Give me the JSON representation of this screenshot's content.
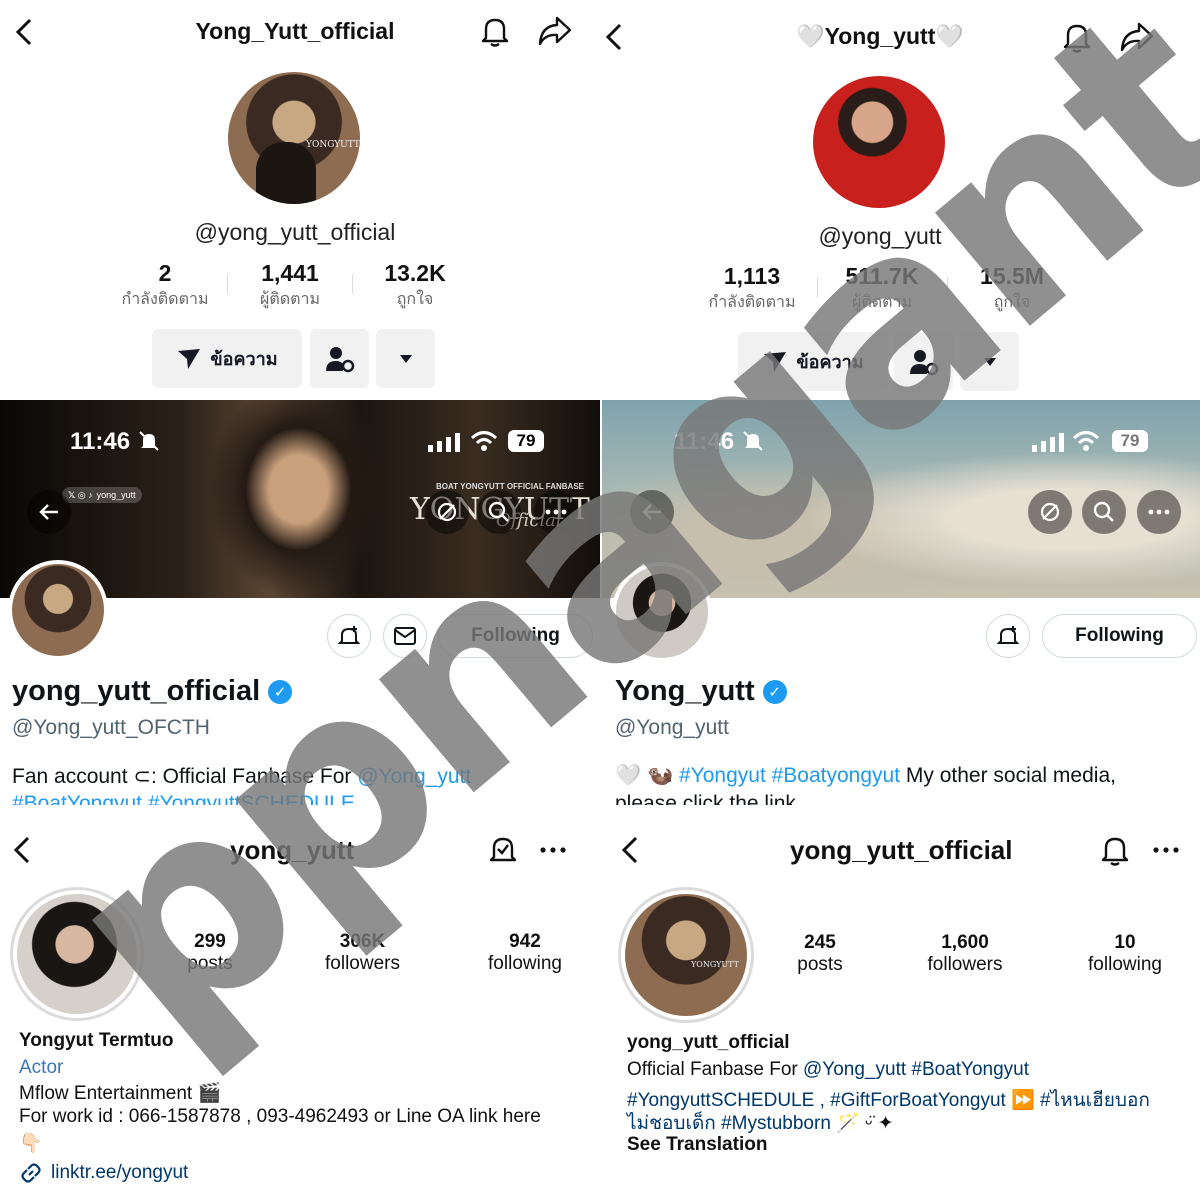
{
  "tiktok_official": {
    "title": "Yong_Yutt_official",
    "handle": "@yong_yutt_official",
    "stats": [
      {
        "value": "2",
        "label": "กำลังติดตาม"
      },
      {
        "value": "1,441",
        "label": "ผู้ติดตาม"
      },
      {
        "value": "13.2K",
        "label": "ถูกใจ"
      }
    ],
    "message_button": "ข้อความ",
    "avatar_logo_text": "YONGYUTT"
  },
  "tiktok_personal": {
    "title": "🤍Yong_yutt🤍",
    "handle": "@yong_yutt",
    "stats": [
      {
        "value": "1,113",
        "label": "กำลังติดตาม"
      },
      {
        "value": "511.7K",
        "label": "ผู้ติดตาม"
      },
      {
        "value": "15.5M",
        "label": "ถูกใจ"
      }
    ],
    "message_button": "ข้อความ"
  },
  "twitter_official": {
    "status_time": "11:46",
    "battery": "79",
    "banner_text_small": "BOAT YONGYUTT OFFICIAL FANBASE",
    "banner_text_big": "YONGYUTT",
    "banner_text_script": "Official",
    "banner_socials": "yong_yutt",
    "following_button": "Following",
    "display_name": "yong_yutt_official",
    "handle": "@Yong_yutt_OFCTH",
    "bio_prefix": "Fan account ⊂: Official Fanbase For ",
    "bio_mention": "@Yong_yutt",
    "bio_line2": "#BoatYongyut #YongyuttSCHEDULE"
  },
  "twitter_personal": {
    "status_time": "11:46",
    "battery": "79",
    "following_button": "Following",
    "display_name": "Yong_yutt",
    "handle": "@Yong_yutt",
    "bio_prefix": "🤍 🦦 ",
    "bio_tags": "#Yongyut #Boatyongyut",
    "bio_suffix": " My other social media,",
    "bio_line2": "please click the link"
  },
  "instagram_personal": {
    "title": "yong_yutt",
    "stats": [
      {
        "value": "299",
        "label": "posts"
      },
      {
        "value": "306K",
        "label": "followers"
      },
      {
        "value": "942",
        "label": "following"
      }
    ],
    "name": "Yongyut Termtuo",
    "category": "Actor",
    "bio_line1": "Mflow Entertainment 🎬",
    "bio_line2": "For work id : 066-1587878 , 093-4962493 or Line OA link here",
    "bio_emoji": "👇🏻",
    "link": "linktr.ee/yongyut"
  },
  "instagram_official": {
    "title": "yong_yutt_official",
    "stats": [
      {
        "value": "245",
        "label": "posts"
      },
      {
        "value": "1,600",
        "label": "followers"
      },
      {
        "value": "10",
        "label": "following"
      }
    ],
    "name": "yong_yutt_official",
    "bio_line1_prefix": "Official Fanbase For ",
    "bio_line1_links": "@Yong_yutt #BoatYongyut",
    "bio_line2": "#YongyuttSCHEDULE , #GiftForBoatYongyut ⏩ #ไหนเฮียบอก",
    "bio_line3": "ไม่ชอบเด็ก #Mystubborn",
    "bio_line3_suffix": " 🪄 ᵕ̈ ✦",
    "see_translation": "See Translation",
    "avatar_logo_text": "YONGYUTT"
  },
  "watermark": "ppnagant"
}
